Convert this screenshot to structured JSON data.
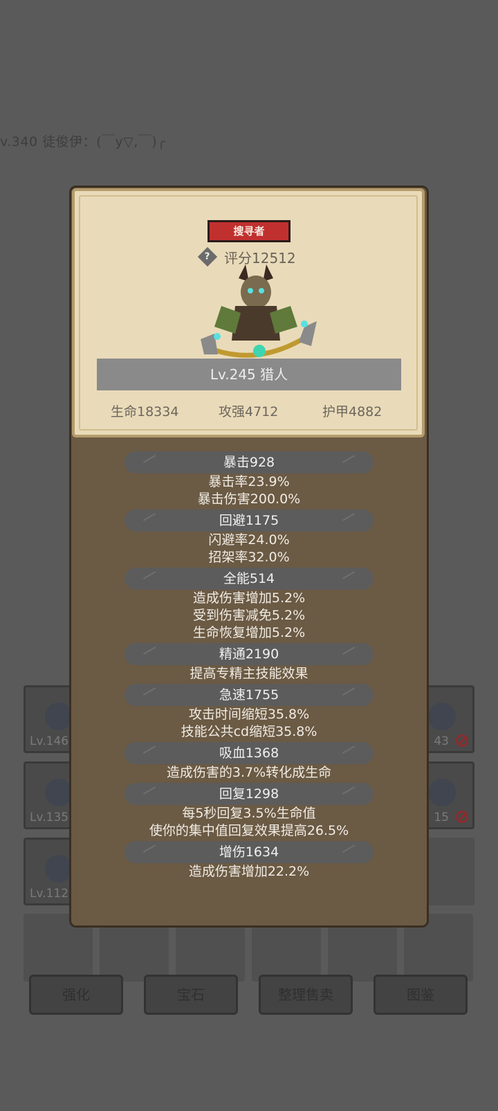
{
  "background": {
    "player_line": "v.340 徒俊伊：(￣y▽,￣)╭",
    "slots_left": [
      {
        "level": "Lv.146"
      },
      {
        "level": "Lv.135"
      },
      {
        "level": "Lv.112"
      }
    ],
    "slots_right": [
      {
        "level": "43"
      },
      {
        "level": "15"
      }
    ],
    "bottom_buttons": [
      "强化",
      "宝石",
      "整理售卖",
      "图鉴"
    ]
  },
  "card": {
    "badge": "搜寻者",
    "help_glyph": "?",
    "score": "评分12512",
    "level_name": "Lv.245 猎人",
    "hp": "生命18334",
    "atk": "攻强4712",
    "armor": "护甲4882"
  },
  "stats": [
    {
      "title": "暴击928",
      "lines": [
        "暴击率23.9%",
        "暴击伤害200.0%"
      ]
    },
    {
      "title": "回避1175",
      "lines": [
        "闪避率24.0%",
        "招架率32.0%"
      ]
    },
    {
      "title": "全能514",
      "lines": [
        "造成伤害增加5.2%",
        "受到伤害减免5.2%",
        "生命恢复增加5.2%"
      ]
    },
    {
      "title": "精通2190",
      "lines": [
        "提高专精主技能效果"
      ]
    },
    {
      "title": "急速1755",
      "lines": [
        "攻击时间缩短35.8%",
        "技能公共cd缩短35.8%"
      ]
    },
    {
      "title": "吸血1368",
      "lines": [
        "造成伤害的3.7%转化成生命"
      ]
    },
    {
      "title": "回复1298",
      "lines": [
        "每5秒回复3.5%生命值",
        "使你的集中值回复效果提高26.5%"
      ]
    },
    {
      "title": "增伤1634",
      "lines": [
        "造成伤害增加22.2%"
      ]
    }
  ]
}
